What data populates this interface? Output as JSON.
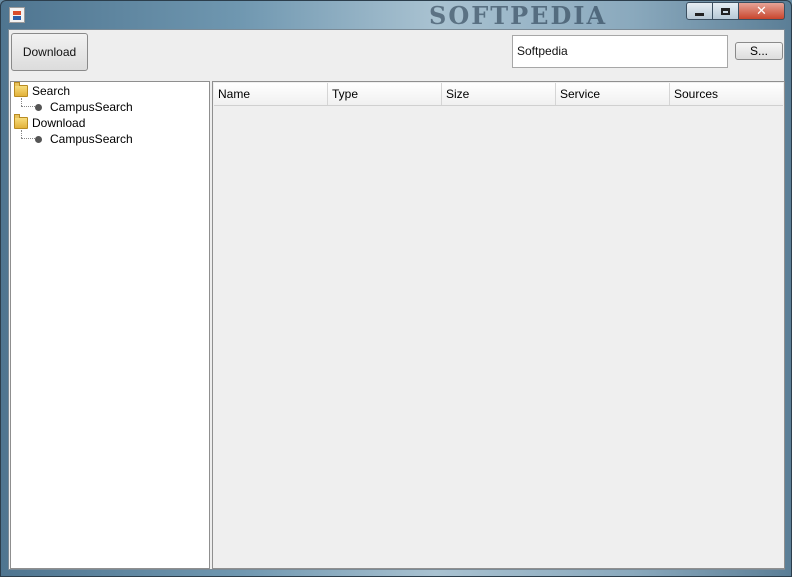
{
  "window": {
    "title_watermark": "SOFTPEDIA",
    "buttons": {
      "minimize": "minimize",
      "maximize": "maximize",
      "close": "✕"
    }
  },
  "toolbar": {
    "download_label": "Download",
    "search_value": "Softpedia",
    "search_button_label": "S..."
  },
  "tree": {
    "nodes": [
      {
        "label": "Search",
        "children": [
          "CampusSearch"
        ]
      },
      {
        "label": "Download",
        "children": [
          "CampusSearch"
        ]
      }
    ]
  },
  "table": {
    "columns": [
      "Name",
      "Type",
      "Size",
      "Service",
      "Sources"
    ]
  }
}
